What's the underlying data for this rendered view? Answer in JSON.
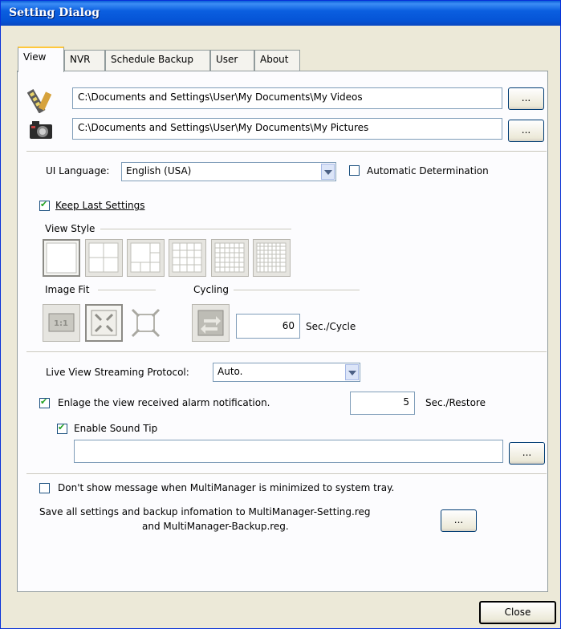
{
  "window": {
    "title": "Setting Dialog"
  },
  "tabs": [
    {
      "label": "View",
      "active": true
    },
    {
      "label": "NVR"
    },
    {
      "label": "Schedule Backup"
    },
    {
      "label": "User"
    },
    {
      "label": "About"
    }
  ],
  "paths": {
    "videos": "C:\\Documents and Settings\\User\\My Documents\\My Videos",
    "pictures": "C:\\Documents and Settings\\User\\My Documents\\My Pictures",
    "browse_label": "..."
  },
  "ui_language": {
    "label": "UI Language:",
    "value": "English (USA)"
  },
  "auto_determination": {
    "label": "Automatic Determination",
    "checked": false
  },
  "keep_last": {
    "label": "Keep Last Settings",
    "checked": true
  },
  "view_style": {
    "label": "View Style"
  },
  "image_fit": {
    "label": "Image Fit"
  },
  "cycling": {
    "label": "Cycling",
    "value": "60",
    "unit": "Sec./Cycle"
  },
  "streaming": {
    "label": "Live View Streaming Protocol:",
    "value": "Auto."
  },
  "enlarge": {
    "label": "Enlage the view received alarm notification.",
    "checked": true,
    "value": "5",
    "unit": "Sec./Restore"
  },
  "sound_tip": {
    "label": "Enable Sound Tip",
    "checked": true,
    "path": ""
  },
  "dont_show": {
    "label": "Don't show message when MultiManager is minimized to system tray.",
    "checked": false
  },
  "save_all": {
    "line1": "Save all settings and backup infomation to MultiManager-Setting.reg",
    "line2": "and MultiManager-Backup.reg."
  },
  "close_label": "Close",
  "colors": {
    "titlebar": "#0554d6",
    "dialog_bg": "#ece9d8",
    "panel_bg": "#fcfcfe",
    "active_tab_accent": "#ffc83c"
  }
}
